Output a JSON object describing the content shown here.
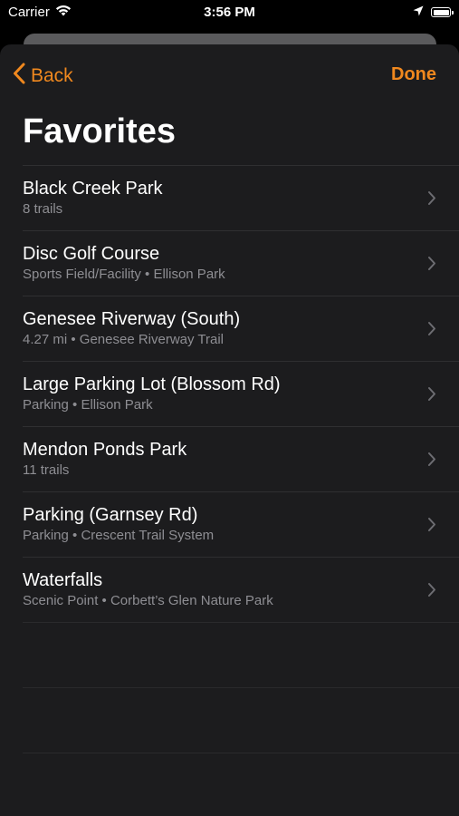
{
  "status_bar": {
    "carrier": "Carrier",
    "time": "3:56 PM"
  },
  "nav": {
    "back_label": "Back",
    "done_label": "Done"
  },
  "title": "Favorites",
  "colors": {
    "accent": "#f0881e",
    "sheet_background": "#1c1c1e",
    "secondary_text": "#8e8e93"
  },
  "items": [
    {
      "title": "Black Creek Park",
      "subtitle": "8 trails"
    },
    {
      "title": "Disc Golf Course",
      "subtitle": "Sports Field/Facility • Ellison Park"
    },
    {
      "title": "Genesee Riverway (South)",
      "subtitle": "4.27 mi • Genesee Riverway Trail"
    },
    {
      "title": "Large Parking Lot (Blossom Rd)",
      "subtitle": "Parking • Ellison Park"
    },
    {
      "title": "Mendon Ponds Park",
      "subtitle": "11 trails"
    },
    {
      "title": "Parking (Garnsey Rd)",
      "subtitle": "Parking • Crescent Trail System"
    },
    {
      "title": "Waterfalls",
      "subtitle": "Scenic Point • Corbett’s Glen Nature Park"
    }
  ]
}
